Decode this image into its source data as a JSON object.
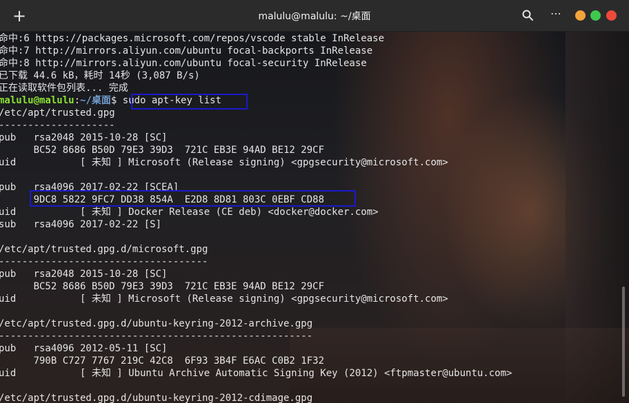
{
  "window": {
    "title": "malulu@malulu: ~/桌面",
    "new_tab_icon": "+",
    "menu_icon": "⋯"
  },
  "prompt": {
    "user_host": "malulu@malulu",
    "sep": ":",
    "path": "~/桌面",
    "symbol": "$ ",
    "command": "sudo apt-key list"
  },
  "lines_before": [
    "命中:6 https://packages.microsoft.com/repos/vscode stable InRelease",
    "命中:7 http://mirrors.aliyun.com/ubuntu focal-backports InRelease",
    "命中:8 http://mirrors.aliyun.com/ubuntu focal-security InRelease",
    "已下载 44.6 kB，耗时 14秒 (3,087 B/s)",
    "正在读取软件包列表... 完成"
  ],
  "lines_after": [
    "/etc/apt/trusted.gpg",
    "--------------------",
    "pub   rsa2048 2015-10-28 [SC]",
    "      BC52 8686 B50D 79E3 39D3  721C EB3E 94AD BE12 29CF",
    "uid           [ 未知 ] Microsoft (Release signing) <gpgsecurity@microsoft.com>",
    "",
    "pub   rsa4096 2017-02-22 [SCEA]",
    "      9DC8 5822 9FC7 DD38 854A  E2D8 8D81 803C 0EBF CD88",
    "uid           [ 未知 ] Docker Release (CE deb) <docker@docker.com>",
    "sub   rsa4096 2017-02-22 [S]",
    "",
    "/etc/apt/trusted.gpg.d/microsoft.gpg",
    "------------------------------------",
    "pub   rsa2048 2015-10-28 [SC]",
    "      BC52 8686 B50D 79E3 39D3  721C EB3E 94AD BE12 29CF",
    "uid           [ 未知 ] Microsoft (Release signing) <gpgsecurity@microsoft.com>",
    "",
    "/etc/apt/trusted.gpg.d/ubuntu-keyring-2012-archive.gpg",
    "------------------------------------------------------",
    "pub   rsa4096 2012-05-11 [SC]",
    "      790B C727 7767 219C 42C8  6F93 3B4F E6AC C0B2 1F32",
    "uid           [ 未知 ] Ubuntu Archive Automatic Signing Key (2012) <ftpmaster@ubuntu.com>",
    "",
    "/etc/apt/trusted.gpg.d/ubuntu-keyring-2012-cdimage.gpg"
  ]
}
